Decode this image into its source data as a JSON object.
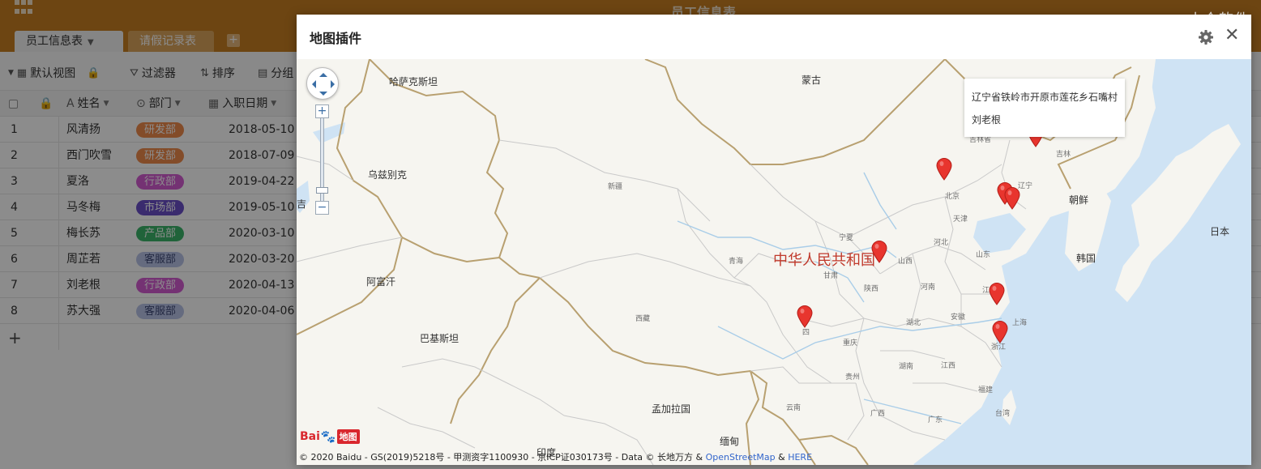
{
  "app": {
    "doc_title": "员工信息表",
    "tabs": [
      {
        "label": "员工信息表"
      },
      {
        "label": "请假记录表"
      }
    ],
    "add_tab_label": "+",
    "watermark": "小众软件"
  },
  "toolbar": {
    "view_label": "默认视图",
    "filter_label": "过滤器",
    "sort_label": "排序",
    "group_label": "分组"
  },
  "table": {
    "columns": {
      "name": "姓名",
      "dept": "部门",
      "date": "入职日期"
    },
    "rows": [
      {
        "num": "1",
        "name": "风清扬",
        "dept": "研发部",
        "date": "2018-05-10",
        "dept_color": "#ef8a4c"
      },
      {
        "num": "2",
        "name": "西门吹雪",
        "dept": "研发部",
        "date": "2018-07-09",
        "dept_color": "#ef8a4c"
      },
      {
        "num": "3",
        "name": "夏洛",
        "dept": "行政部",
        "date": "2019-04-22",
        "dept_color": "#d45bd2"
      },
      {
        "num": "4",
        "name": "马冬梅",
        "dept": "市场部",
        "date": "2019-05-10",
        "dept_color": "#6a4fc9"
      },
      {
        "num": "5",
        "name": "梅长苏",
        "dept": "产品部",
        "date": "2020-03-10",
        "dept_color": "#3bb56a"
      },
      {
        "num": "6",
        "name": "周芷若",
        "dept": "客服部",
        "date": "2020-03-20",
        "dept_color": "#b9c4e8"
      },
      {
        "num": "7",
        "name": "刘老根",
        "dept": "行政部",
        "date": "2020-04-13",
        "dept_color": "#d45bd2"
      },
      {
        "num": "8",
        "name": "苏大强",
        "dept": "客服部",
        "date": "2020-04-06",
        "dept_color": "#b9c4e8"
      }
    ],
    "add_row_label": "+"
  },
  "modal": {
    "title": "地图插件",
    "close_label": "✕"
  },
  "map": {
    "labels": {
      "kazakhstan": "哈萨克斯坦",
      "mongolia": "蒙古",
      "uzbekistan": "乌兹别克",
      "afghanistan": "阿富汗",
      "pakistan": "巴基斯坦",
      "china": "中华人民共和国",
      "north_korea": "朝鲜",
      "south_korea": "韩国",
      "japan": "日本",
      "bangladesh": "孟加拉国",
      "myanmar": "缅甸",
      "india": "印度",
      "edge_char": "吉"
    },
    "provinces": {
      "xinjiang": "新疆",
      "qinghai": "青海",
      "xizang": "西藏",
      "gansu": "甘肃",
      "ningxia": "宁夏",
      "shaanxi": "陕西",
      "shanxi": "山西",
      "henan": "河南",
      "hubei": "湖北",
      "chongqing": "重庆",
      "guizhou": "贵州",
      "yunnan": "云南",
      "guangxi": "广西",
      "guangdong": "广东",
      "hunan": "湖南",
      "jiangxi": "江西",
      "fujian": "福建",
      "zhejiang": "浙江",
      "anhui": "安徽",
      "jiangsu": "江苏",
      "shanghai": "上海",
      "shandong": "山东",
      "hebei": "河北",
      "beijing": "北京",
      "tianjin": "天津",
      "liaoning": "辽宁",
      "jilin": "吉林",
      "taiwan": "台湾",
      "sichuan_partial": "四",
      "jilin_partial": "吉林省"
    },
    "popup": {
      "address": "辽宁省铁岭市开原市莲花乡石嘴村",
      "name": "刘老根"
    },
    "logo": {
      "bai": "Bai",
      "paw": "🐾",
      "map": "地图"
    },
    "copyright": {
      "text": "© 2020 Baidu - GS(2019)5218号 - 甲测资字1100930 - 京ICP证030173号 - Data © 长地万方 & ",
      "osm": "OpenStreetMap",
      "amp": " & ",
      "here": "HERE"
    },
    "zoom_in": "+",
    "zoom_out": "−"
  }
}
